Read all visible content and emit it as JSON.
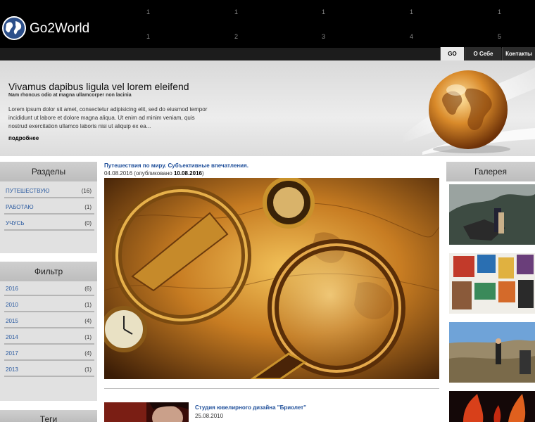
{
  "header": {
    "brand": "Go2World",
    "numbers_top": [
      "1",
      "1",
      "1",
      "1",
      "1"
    ],
    "numbers_bottom": [
      "1",
      "2",
      "3",
      "4",
      "5"
    ]
  },
  "nav": {
    "items": [
      {
        "label": "GO",
        "active": true
      },
      {
        "label": "О Себе",
        "active": false
      },
      {
        "label": "Контакты",
        "active": false
      }
    ]
  },
  "hero": {
    "title": "Vivamus dapibus ligula vel lorem eleifend",
    "subtitle": "Nam rhoncus odio at magna ullamcorper non lacinia",
    "text": "Lorem ipsum dolor sit amet, consectetur adipisicing elit, sed do eiusmod tempor incididunt ut labore et dolore magna aliqua. Ut enim ad minim veniam, quis nostrud exercitation ullamco laboris nisi ut aliquip ex ea...",
    "more": "подробнее"
  },
  "sections": {
    "title": "Разделы",
    "items": [
      {
        "label": "ПУТЕШЕСТВУЮ",
        "count": "(16)"
      },
      {
        "label": "РАБОТАЮ",
        "count": "(1)"
      },
      {
        "label": "УЧУСЬ",
        "count": "(0)"
      }
    ]
  },
  "filter": {
    "title": "Фильтр",
    "items": [
      {
        "label": "2016",
        "count": "(6)"
      },
      {
        "label": "2010",
        "count": "(1)"
      },
      {
        "label": "2015",
        "count": "(4)"
      },
      {
        "label": "2014",
        "count": "(1)"
      },
      {
        "label": "2017",
        "count": "(4)"
      },
      {
        "label": "2013",
        "count": "(1)"
      }
    ]
  },
  "tags": {
    "title": "Теги"
  },
  "posts": [
    {
      "title": "Путешествия по миру. Субъективные впечатления.",
      "date": "04.08.2016",
      "published_label": "(опубликовано",
      "published_date": "10.08.2016",
      "published_close": ")"
    },
    {
      "title": "Студия ювелирного дизайна \"Бриолет\"",
      "date": "25.08.2010"
    }
  ],
  "gallery": {
    "title": "Галерея"
  },
  "colors": {
    "link": "#2a5aa0",
    "post_title": "#1f4f9a",
    "header_bg": "#000000",
    "panel_bg": "#e1e1e1"
  }
}
